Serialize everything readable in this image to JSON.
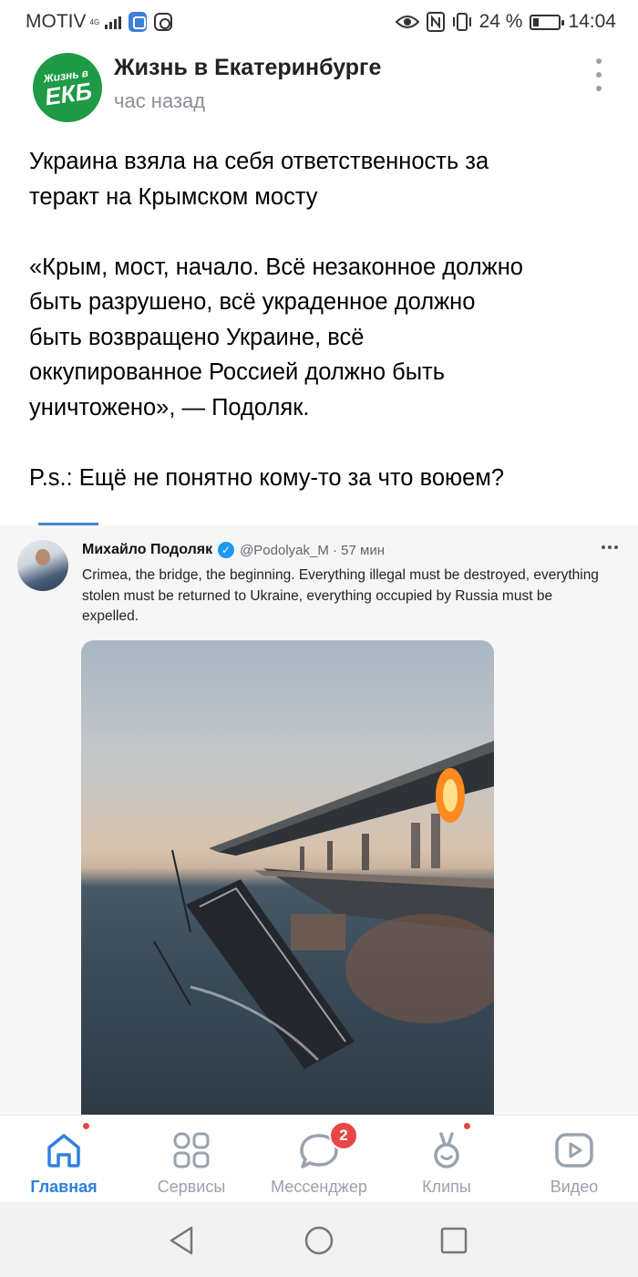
{
  "status_bar": {
    "carrier": "MOTIV",
    "network": "4G",
    "battery_percent": "24 %",
    "battery_level": 0.24,
    "time": "14:04",
    "icons": [
      "signal-icon",
      "shield-icon",
      "instagram-icon",
      "eye-icon",
      "nfc-icon",
      "vibrate-icon",
      "battery-icon"
    ]
  },
  "post": {
    "group_avatar_text_top": "Жизнь в",
    "group_avatar_text_bottom": "ЕКБ",
    "group_name": "Жизнь в Екатеринбурге",
    "time": "час назад",
    "paragraph1": "Украина взяла на себя ответственность за\nтеракт на Крымском мосту",
    "paragraph2": "«Крым, мост, начало. Всё незаконное должно\nбыть разрушено, всё украденное должно\nбыть возвращено Украине, всё\nоккупированное Россией должно быть\nуничтожено», — Подоляк.",
    "paragraph3": "P.s.: Ещё не понятно кому-то за что воюем?"
  },
  "tweet": {
    "author_name": "Михайло Подоляк",
    "handle_time": "@Podolyak_M · 57 мин",
    "text": "Crimea, the bridge, the beginning. Everything illegal must be destroyed, everything stolen must be returned to Ukraine, everything occupied by Russia must be expelled.",
    "verified_icon": "✓"
  },
  "tabbar": {
    "tabs": [
      {
        "label": "Главная",
        "icon": "home-icon",
        "active": true,
        "dot": true
      },
      {
        "label": "Сервисы",
        "icon": "services-icon",
        "active": false,
        "dot": false
      },
      {
        "label": "Мессенджер",
        "icon": "messenger-icon",
        "active": false,
        "badge": "2"
      },
      {
        "label": "Клипы",
        "icon": "clips-icon",
        "active": false,
        "dot": true
      },
      {
        "label": "Видео",
        "icon": "video-icon",
        "active": false,
        "dot": false
      }
    ],
    "active_color": "#2d81e0",
    "inactive_color": "#99a2ad",
    "badge_color": "#e64646"
  },
  "navbar": {
    "buttons": [
      "back-icon",
      "home-circle-icon",
      "recents-icon"
    ]
  }
}
